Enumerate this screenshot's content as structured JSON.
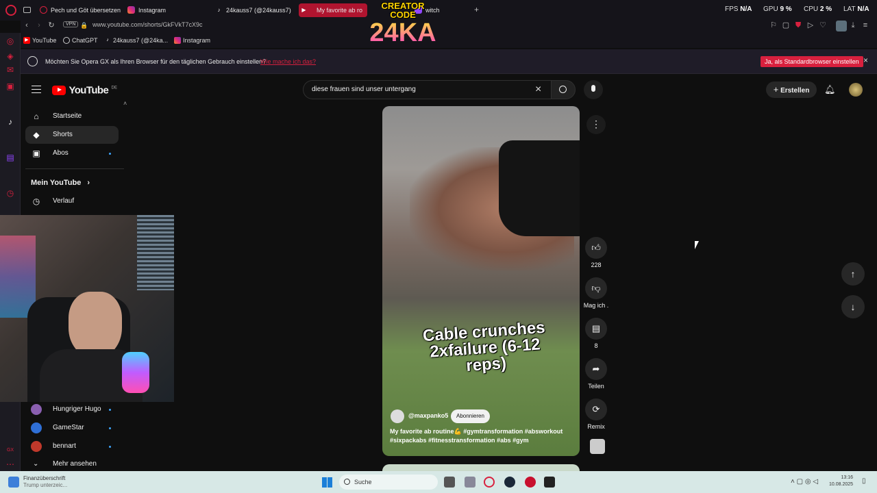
{
  "tabs": [
    {
      "label": "Pech und Göt übersetzen",
      "icon": "opera-icon"
    },
    {
      "label": "Instagram",
      "icon": "instagram-icon"
    },
    {
      "label": "24kauss7 (@24kauss7)",
      "icon": "tiktok-icon"
    },
    {
      "label": "My favorite ab ro",
      "icon": "youtube-icon",
      "active": true
    },
    {
      "label": "witch",
      "icon": "twitch-icon"
    }
  ],
  "new_tab": "+",
  "stats": [
    {
      "label": "FPS",
      "value": "N/A"
    },
    {
      "label": "GPU",
      "value": "9 %"
    },
    {
      "label": "CPU",
      "value": "2 %"
    },
    {
      "label": "LAT",
      "value": "N/A"
    }
  ],
  "address": {
    "vpn": "VPN",
    "url": "www.youtube.com/shorts/GkFVkT7cX9c"
  },
  "bookmarks": [
    "YouTube",
    "ChatGPT",
    "24kauss7 (@24ka...",
    "Instagram"
  ],
  "overlay": {
    "line1": "CREATOR",
    "line2": "CODE",
    "brand": "24KA"
  },
  "infobar": {
    "text": "Möchten Sie Opera GX als Ihren Browser für den täglichen Gebrauch einstellen?",
    "link": "Wie mache ich das?",
    "button": "Ja, als Standardbrowser einstellen",
    "close": "×"
  },
  "yt": {
    "logo_text": "YouTube",
    "country": "DE",
    "search_value": "diese frauen sind unser untergang",
    "create_label": "Erstellen"
  },
  "sidebar": {
    "items": [
      {
        "label": "Startseite",
        "icon": "home-icon"
      },
      {
        "label": "Shorts",
        "icon": "shorts-icon"
      },
      {
        "label": "Abos",
        "icon": "subscriptions-icon"
      }
    ],
    "section": "Mein YouTube",
    "history": "Verlauf",
    "subscriptions": [
      {
        "name": "Hungriger Hugo",
        "color": "#8a5fb0"
      },
      {
        "name": "GameStar",
        "color": "#2f6fd6"
      },
      {
        "name": "bennart",
        "color": "#c0392b"
      }
    ],
    "more": "Mehr ansehen"
  },
  "video": {
    "caption": "Cable crunches 2xfailure (6-12 reps)",
    "channel": "@maxpanko5",
    "subscribe": "Abonnieren",
    "description": "My favorite ab routine💪 #gymtransformation #absworkout #sixpackabs #fitnesstransformation #abs #gym"
  },
  "actions": {
    "like_count": "228",
    "dislike_label": "Mag ich .",
    "comments_count": "8",
    "share_label": "Teilen",
    "remix_label": "Remix"
  },
  "taskbar": {
    "weather_title": "Finanzüberschrift",
    "weather_sub": "Trump unterzeic...",
    "search": "Suche",
    "time": "13:16",
    "date": "10.08.2025"
  }
}
